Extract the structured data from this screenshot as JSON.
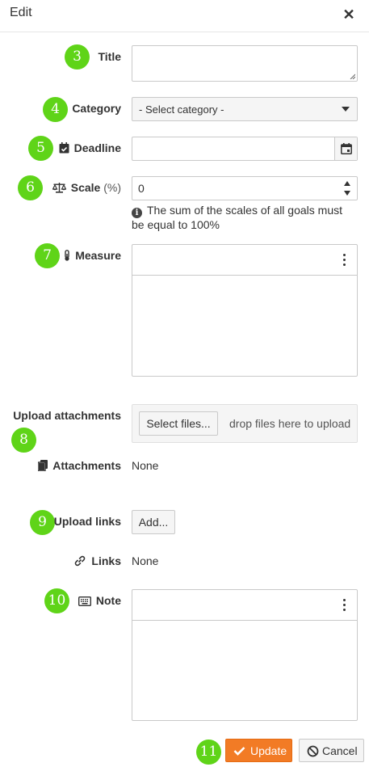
{
  "dialog": {
    "title": "Edit",
    "close_glyph": "✕"
  },
  "badges": {
    "title": "3",
    "category": "4",
    "deadline": "5",
    "scale": "6",
    "measure": "7",
    "upload_attachments": "8",
    "upload_links": "9",
    "note": "10",
    "update": "11"
  },
  "badge_color": "#5fd418",
  "fields": {
    "title": {
      "label": "Title",
      "value": ""
    },
    "category": {
      "label": "Category",
      "selected": "- Select category -"
    },
    "deadline": {
      "label": "Deadline",
      "value": "",
      "icon": "calendar-check-icon"
    },
    "scale": {
      "label": "Scale",
      "unit": "(%)",
      "value": "0",
      "icon": "balance-scale-icon",
      "hint": "The sum of the scales of all goals must be equal to 100%"
    },
    "measure": {
      "label": "Measure",
      "icon": "thermometer-icon"
    },
    "upload_attachments": {
      "label": "Upload attachments",
      "select_button": "Select files...",
      "drop_text": "drop files here to upload"
    },
    "attachments": {
      "label": "Attachments",
      "value": "None",
      "icon": "copy-icon"
    },
    "upload_links": {
      "label": "Upload links",
      "add_button": "Add..."
    },
    "links": {
      "label": "Links",
      "value": "None",
      "icon": "link-icon"
    },
    "note": {
      "label": "Note",
      "icon": "keyboard-icon"
    }
  },
  "footer": {
    "update_label": "Update",
    "cancel_label": "Cancel",
    "accent": "#f27b25"
  }
}
